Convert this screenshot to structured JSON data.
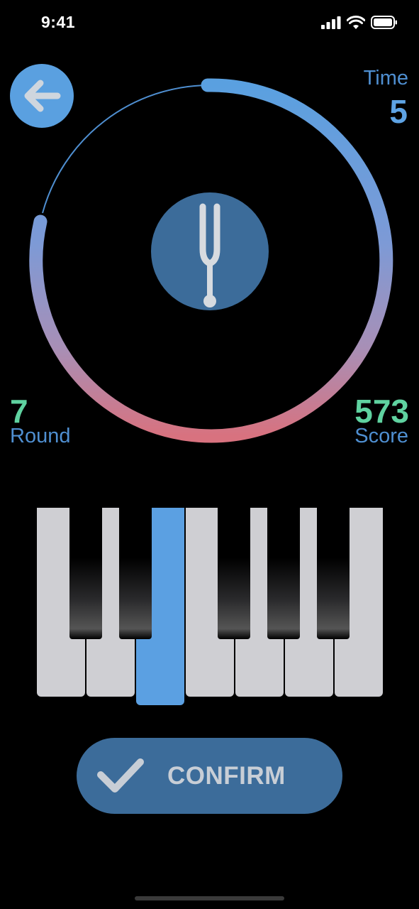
{
  "status_bar": {
    "time": "9:41",
    "icons": [
      "cellular-signal-icon",
      "wifi-icon",
      "battery-icon"
    ]
  },
  "header": {
    "back_icon": "arrow-left-icon",
    "time_label": "Time",
    "time_value": "5"
  },
  "timer_ring": {
    "remaining_fraction": 0.72,
    "gradient_start": "#5aa0e0",
    "gradient_end": "#d8727f",
    "track_color": "#4f8fd1"
  },
  "center_button": {
    "icon": "tuning-fork-icon"
  },
  "stats": {
    "round_value": "7",
    "round_label": "Round",
    "score_value": "573",
    "score_label": "Score"
  },
  "piano": {
    "white_keys": 7,
    "selected_white_key": 2,
    "black_key_after": [
      0,
      1,
      3,
      4,
      5
    ]
  },
  "confirm": {
    "label": "CONFIRM",
    "icon": "checkmark-icon"
  },
  "colors": {
    "accent": "#5aa0e0",
    "button_bg": "#3c6c9a",
    "stat_value": "#5fd2a0",
    "stat_label": "#4f8fd1",
    "background": "#000000"
  }
}
